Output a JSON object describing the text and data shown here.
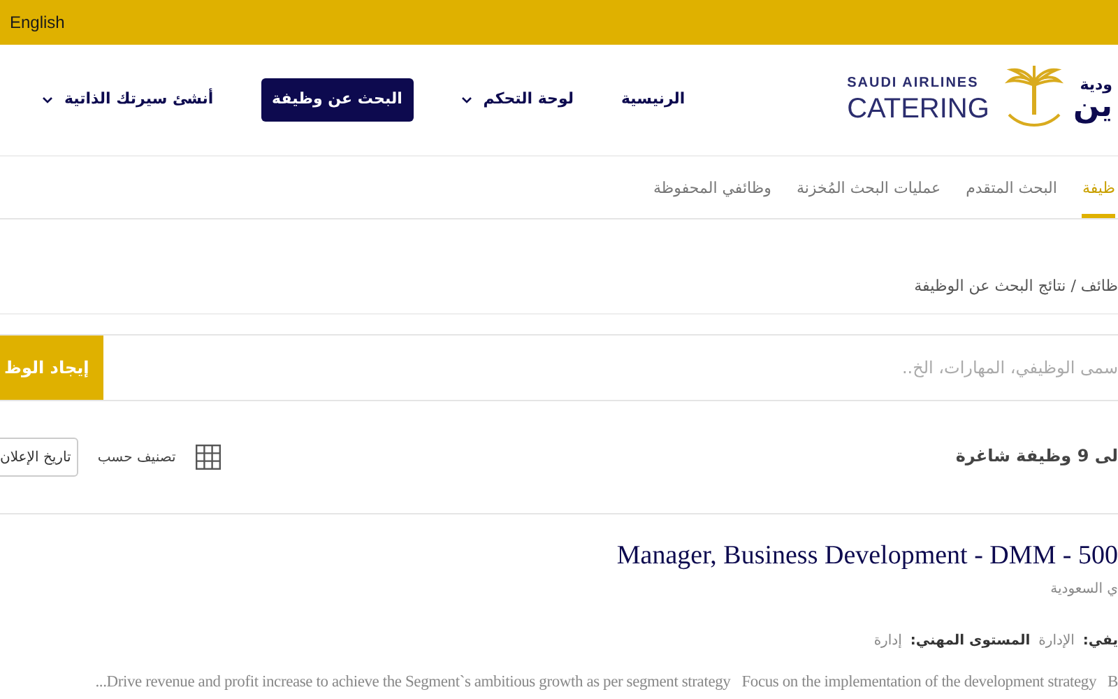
{
  "top_bar": {
    "language_link": "English"
  },
  "header": {
    "logo": {
      "arabic_top": "ودية",
      "arabic_bottom": "ين",
      "line1": "SAUDI AIRLINES",
      "line2": "CATERING"
    },
    "nav": [
      {
        "label": "الرنيسية",
        "kind": "link",
        "dropdown": false
      },
      {
        "label": "لوحة التحكم",
        "kind": "link",
        "dropdown": true
      },
      {
        "label": "البحث عن وظيفة",
        "kind": "button",
        "dropdown": false
      },
      {
        "label": "أنشئ سيرتك الذاتية",
        "kind": "link",
        "dropdown": true
      }
    ]
  },
  "tabs": [
    {
      "label": "ظيفة",
      "selected": true
    },
    {
      "label": "البحث المتقدم",
      "selected": false
    },
    {
      "label": "عمليات البحث المُخزنة",
      "selected": false
    },
    {
      "label": "وظائفي المحفوظة",
      "selected": false
    }
  ],
  "breadcrumb": "ظائف / نتائج البحث عن الوظيفة",
  "search": {
    "placeholder": "سمى الوظيفي، المهارات، الخ..",
    "button": "إيجاد الوظ"
  },
  "results": {
    "count": "لى 9 وظيفة شاغرة",
    "sort_label": "تصنيف حسب",
    "sort_value": "تاريخ الإعلان"
  },
  "job": {
    "title": "Manager, Business Development - DMM - 500",
    "location": "ي السعودية",
    "meta": [
      {
        "label": "يفي:",
        "value": "الإدارة"
      },
      {
        "label": "المستوى المهني:",
        "value": "إدارة"
      }
    ],
    "description": "...Drive revenue and profit increase to achieve the Segment`s ambitious growth as per segment strategy   Focus on the implementation of the development strategy   B"
  }
}
